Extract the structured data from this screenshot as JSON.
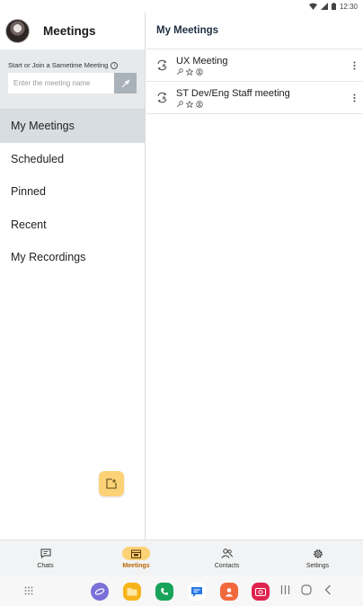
{
  "status_bar": {
    "time": "12:30"
  },
  "left_panel": {
    "title": "Meetings",
    "join": {
      "label": "Start or Join a Sametime Meeting",
      "placeholder": "Enter the meeting name"
    },
    "nav": [
      {
        "label": "My Meetings",
        "active": true
      },
      {
        "label": "Scheduled",
        "active": false
      },
      {
        "label": "Pinned",
        "active": false
      },
      {
        "label": "Recent",
        "active": false
      },
      {
        "label": "My Recordings",
        "active": false
      }
    ]
  },
  "main": {
    "title": "My Meetings",
    "meetings": [
      {
        "name": "UX Meeting"
      },
      {
        "name": "ST Dev/Eng Staff meeting"
      }
    ]
  },
  "bottom_tabs": [
    {
      "label": "Chats",
      "icon": "chat-icon",
      "active": false
    },
    {
      "label": "Meetings",
      "icon": "meetings-icon",
      "active": true
    },
    {
      "label": "Contacts",
      "icon": "contacts-icon",
      "active": false
    },
    {
      "label": "Settings",
      "icon": "gear-icon",
      "active": false
    }
  ],
  "colors": {
    "accent": "#fcd277",
    "active_nav": "#d8dde1",
    "active_tab_text": "#b8670a"
  }
}
